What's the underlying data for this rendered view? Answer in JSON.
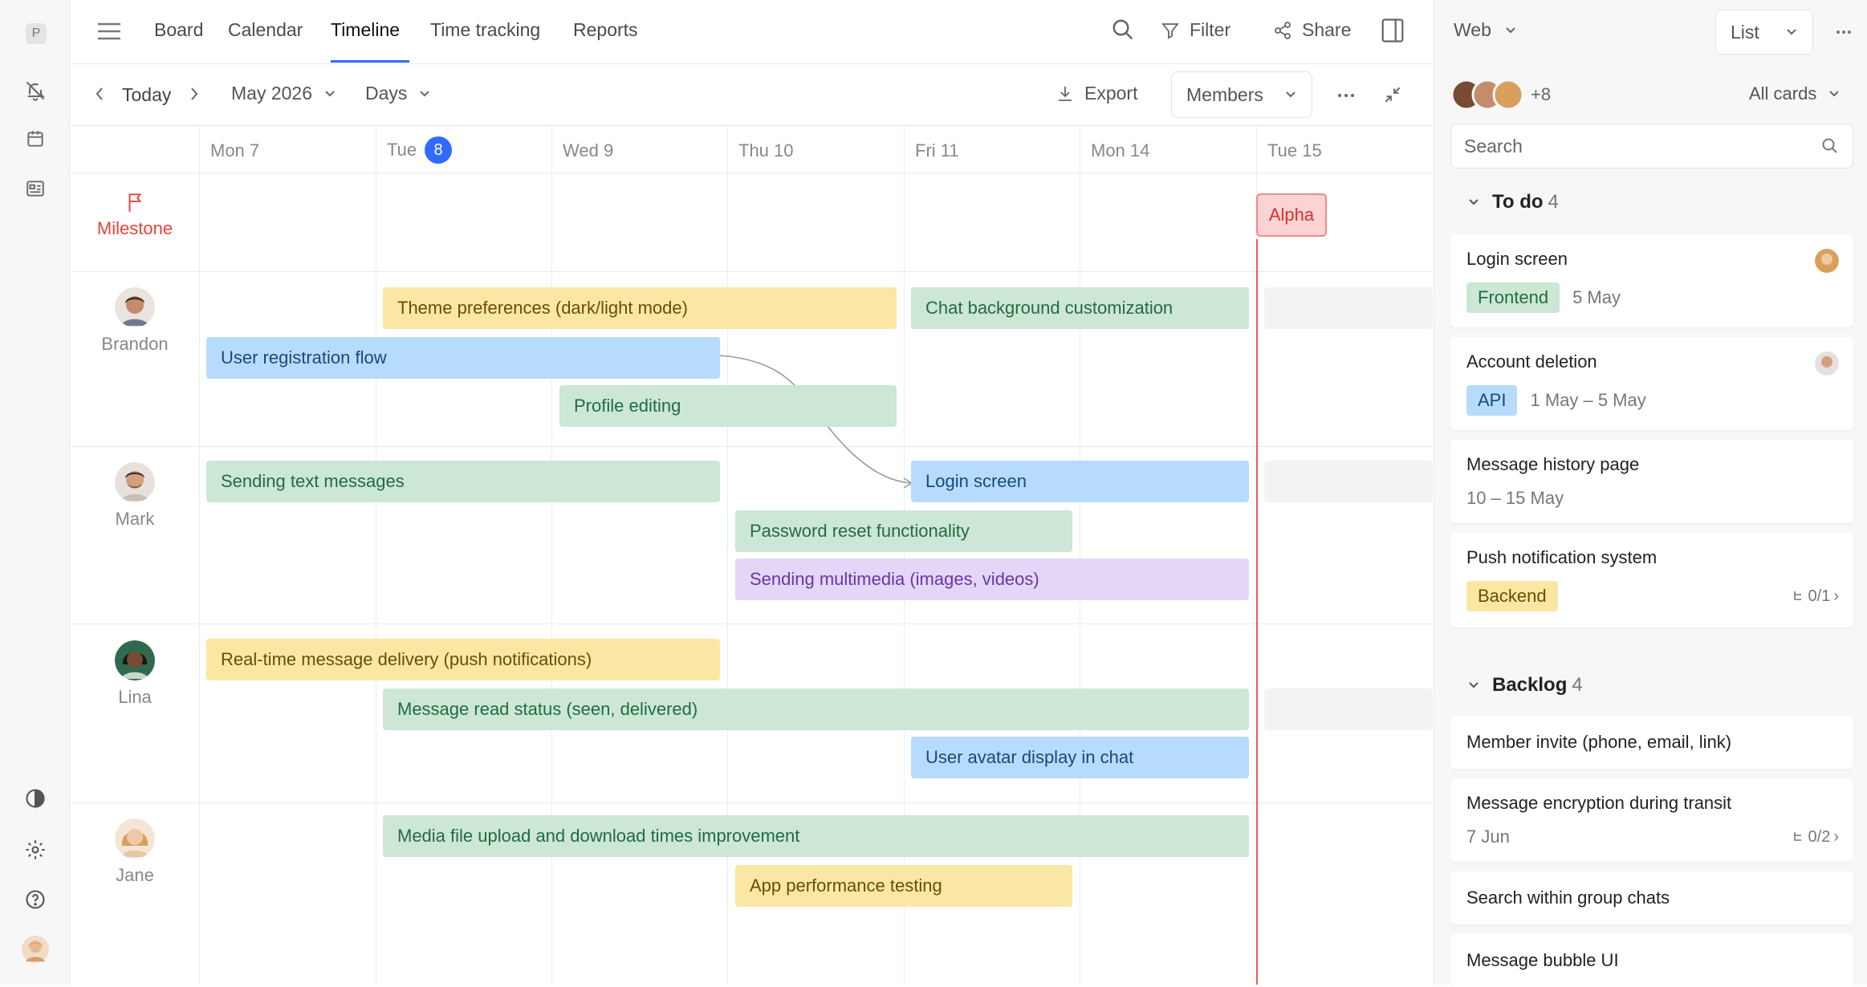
{
  "rail": {
    "logo": "P"
  },
  "nav": {
    "tabs": [
      "Board",
      "Calendar",
      "Timeline",
      "Time tracking",
      "Reports"
    ],
    "active_tab": "Timeline",
    "filter_label": "Filter",
    "share_label": "Share"
  },
  "toolbar": {
    "today_label": "Today",
    "month_label": "May 2026",
    "scale_label": "Days",
    "export_label": "Export",
    "members_label": "Members"
  },
  "days": [
    "Mon 7",
    "Tue",
    "Wed 9",
    "Thu 10",
    "Fri 11",
    "Mon 14",
    "Tue 15"
  ],
  "today_badge": "8",
  "milestone": {
    "label": "Milestone",
    "name": "Alpha"
  },
  "people": [
    {
      "name": "Brandon",
      "skin": "#c58c6a",
      "hair": "#3b2a20"
    },
    {
      "name": "Mark",
      "skin": "#d2a07e",
      "hair": "#4a3426"
    },
    {
      "name": "Lina",
      "skin": "#7a4b34",
      "hair": "#1c1410"
    },
    {
      "name": "Jane",
      "skin": "#f0c9a4",
      "hair": "#d8a05c"
    }
  ],
  "tasks": {
    "theme_prefs": "Theme preferences (dark/light mode)",
    "chat_bg": "Chat background customization",
    "user_reg": "User registration flow",
    "profile_edit": "Profile editing",
    "sending_text": "Sending text messages",
    "login_screen": "Login screen",
    "password_reset": "Password reset functionality",
    "multimedia": "Sending multimedia (images, videos)",
    "realtime": "Real-time message delivery (push notifications)",
    "read_status": "Message read status (seen, delivered)",
    "avatar_display": "User avatar display in chat",
    "media_upload": "Media file upload and download times improvement",
    "perf_testing": "App performance testing"
  },
  "side": {
    "project": "Web",
    "view": "List",
    "members_extra": "+8",
    "filter": "All cards",
    "search_placeholder": "Search",
    "todo": {
      "title": "To do",
      "count": "4",
      "cards": [
        {
          "title": "Login screen",
          "tag": "Frontend",
          "date": "5 May"
        },
        {
          "title": "Account deletion",
          "tag": "API",
          "date": "1 May – 5 May"
        },
        {
          "title": "Message history page",
          "date": "10 – 15 May"
        },
        {
          "title": "Push notification system",
          "tag": "Backend",
          "subtasks": "0/1"
        }
      ]
    },
    "backlog": {
      "title": "Backlog",
      "count": "4",
      "cards": [
        {
          "title": "Member invite (phone, email, link)"
        },
        {
          "title": "Message encryption during transit",
          "date": "7 Jun",
          "subtasks": "0/2"
        },
        {
          "title": "Search within group chats"
        },
        {
          "title": "Message bubble UI"
        }
      ]
    }
  },
  "colors": {
    "accent": "#2f6bff",
    "milestone": "#e3453c"
  }
}
